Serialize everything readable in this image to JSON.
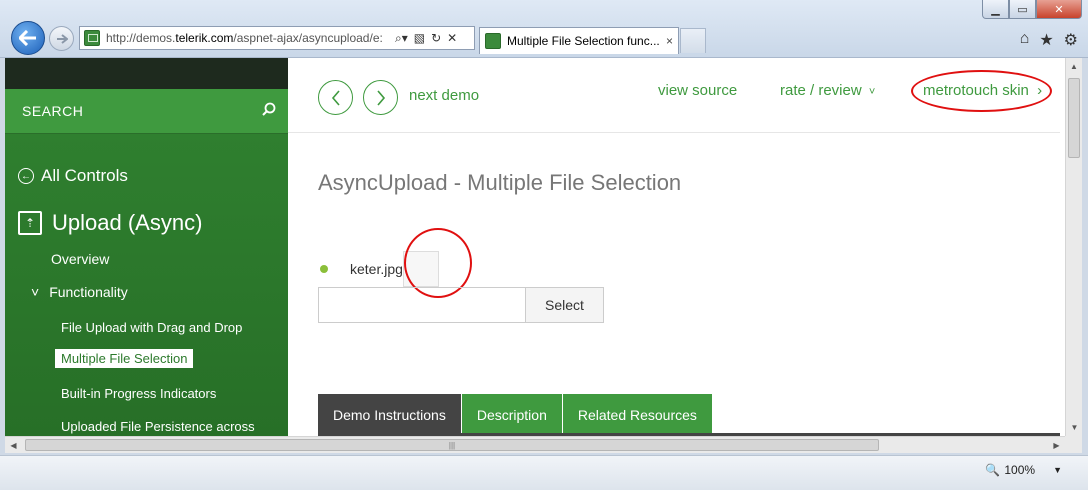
{
  "browser": {
    "url_prefix": "http://demos.",
    "url_domain": "telerik.com",
    "url_suffix": "/aspnet-ajax/asyncupload/e:",
    "tab_title": "Multiple File Selection func...",
    "tab_close": "×",
    "zoom_level": "100%",
    "zoom_arrow": "▼"
  },
  "sidebar": {
    "search_label": "SEARCH",
    "all_controls": "All Controls",
    "section_title": "Upload (Async)",
    "overview": "Overview",
    "functionality": "Functionality",
    "functionality_caret": "˅",
    "items": [
      "File Upload with Drag and Drop",
      "Multiple File Selection",
      "Built-in Progress Indicators",
      "Uploaded File Persistence across"
    ]
  },
  "topbar": {
    "next_demo": "next demo",
    "view_source": "view source",
    "rate_review": "rate / review",
    "rate_caret": "˅",
    "skin": "metrotouch skin",
    "skin_caret": "›"
  },
  "demo": {
    "title": "AsyncUpload - Multiple File Selection",
    "file_name": "keter.jpg",
    "select_label": "Select"
  },
  "tabs": [
    "Demo Instructions",
    "Description",
    "Related Resources"
  ],
  "colors": {
    "accent": "#3f9a3f",
    "sidebar": "#2c7a2c",
    "annotation": "#e01010"
  }
}
